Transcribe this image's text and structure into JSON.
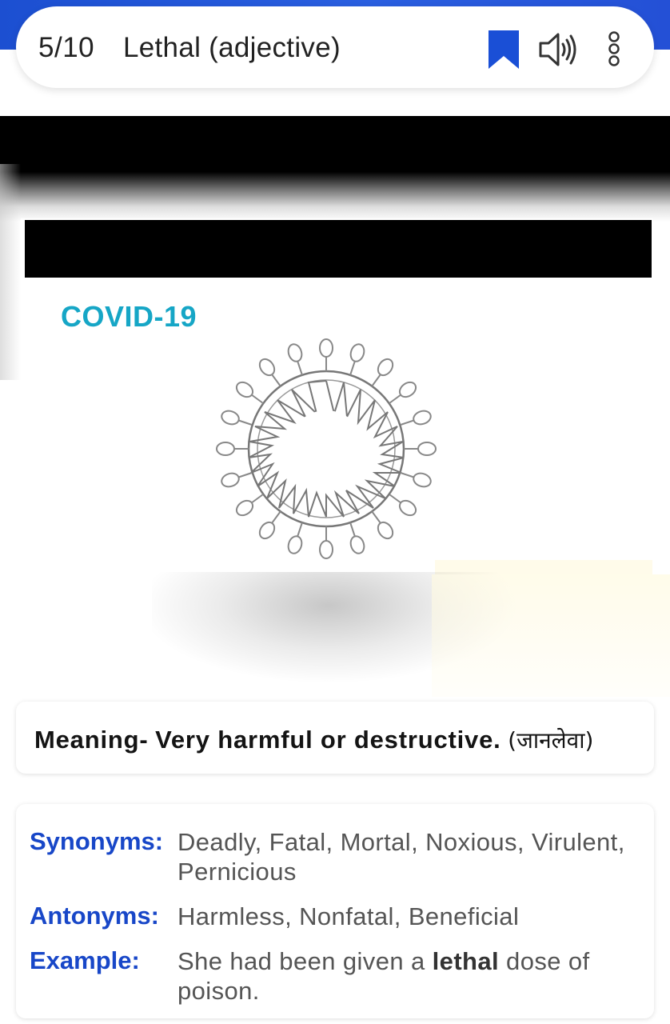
{
  "header": {
    "counter": "5/10",
    "title": "Lethal (adjective)",
    "icons": [
      "bookmark-icon",
      "speaker-icon",
      "more-vertical-icon"
    ],
    "accent_color": "#1a4fd6"
  },
  "media": {
    "caption": "COVID-19"
  },
  "meaning": {
    "label": "Meaning-",
    "text": "Very harmful or destructive.",
    "translation": "(जानलेवा)"
  },
  "details": {
    "synonyms_label": "Synonyms:",
    "synonyms": "Deadly, Fatal, Mortal, Noxious, Virulent, Pernicious",
    "antonyms_label": "Antonyms:",
    "antonyms": "Harmless, Nonfatal, Beneficial",
    "example_label": "Example:",
    "example_before": "She had been given a ",
    "example_highlight": "lethal",
    "example_after": " dose of poison."
  },
  "colors": {
    "label_blue": "#1847c8",
    "covid_teal": "#16a6c6",
    "value_gray": "#555555"
  }
}
